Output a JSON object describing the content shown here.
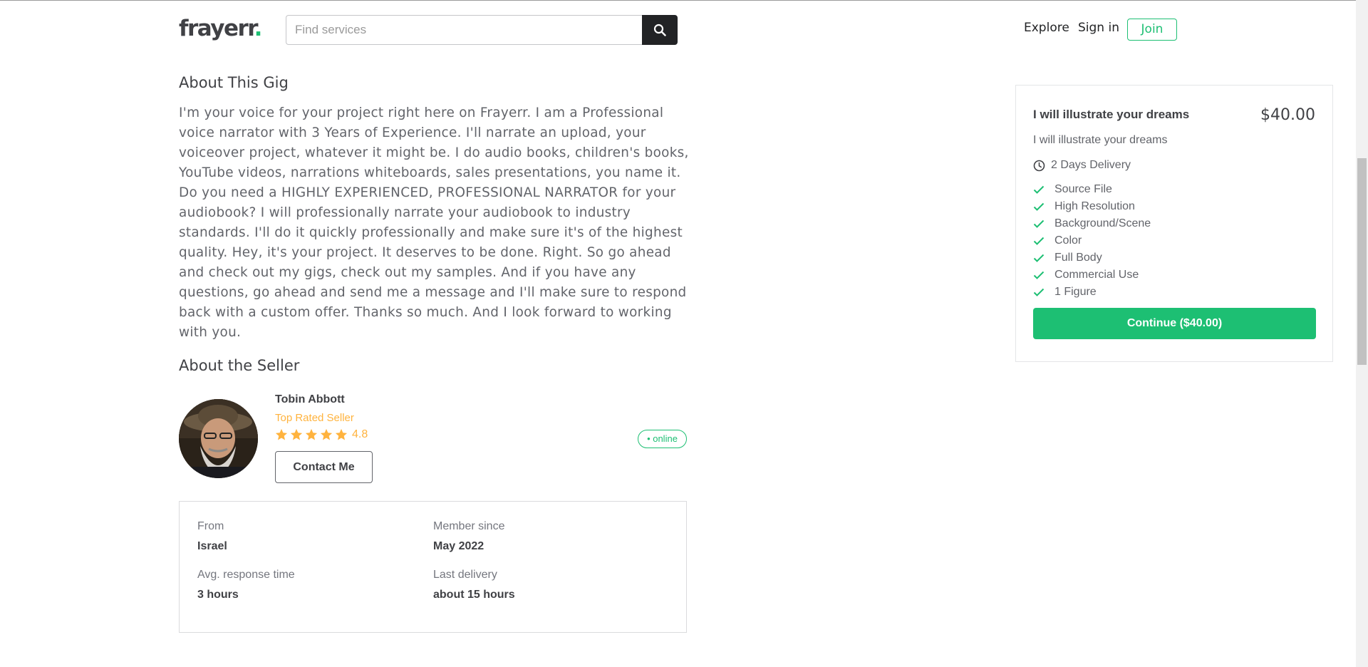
{
  "header": {
    "logo_text": "frayerr",
    "logo_dot": ".",
    "search_placeholder": "Find services",
    "nav_explore": "Explore",
    "nav_signin": "Sign in",
    "join_label": "Join"
  },
  "gig": {
    "about_title": "About This Gig",
    "description": "I'm your voice for your project right here on Frayerr. I am a Professional voice narrator with 3 Years of Experience. I'll narrate an upload, your voiceover project, whatever it might be. I do audio books, children's books, YouTube videos, narrations whiteboards, sales presentations, you name it. Do you need a HIGHLY EXPERIENCED, PROFESSIONAL NARRATOR for your audiobook? I will professionally narrate your audiobook to industry standards. I'll do it quickly professionally and make sure it's of the highest quality. Hey, it's your project. It deserves to be done. Right. So go ahead and check out my gigs, check out my samples. And if you have any questions, go ahead and send me a message and I'll make sure to respond back with a custom offer. Thanks so much. And I look forward to working with you."
  },
  "seller": {
    "section_title": "About the Seller",
    "name": "Tobin Abbott",
    "level": "Top Rated Seller",
    "rating": "4.8",
    "star_count": 5,
    "contact_label": "Contact Me",
    "online_label": "• online",
    "stats": {
      "from_label": "From",
      "from_value": "Israel",
      "member_label": "Member since",
      "member_value": "May 2022",
      "response_label": "Avg. response time",
      "response_value": "3 hours",
      "delivery_label": "Last delivery",
      "delivery_value": "about 15 hours"
    }
  },
  "package": {
    "title": "I will illustrate your dreams",
    "price": "$40.00",
    "description": "I will illustrate your dreams",
    "delivery": "2 Days Delivery",
    "features": [
      "Source File",
      "High Resolution",
      "Background/Scene",
      "Color",
      "Full Body",
      "Commercial Use",
      "1 Figure"
    ],
    "continue_label": "Continue ($40.00)"
  },
  "colors": {
    "brand_green": "#1dbf73",
    "star_orange": "#ffb33e",
    "text_dark": "#404145"
  }
}
